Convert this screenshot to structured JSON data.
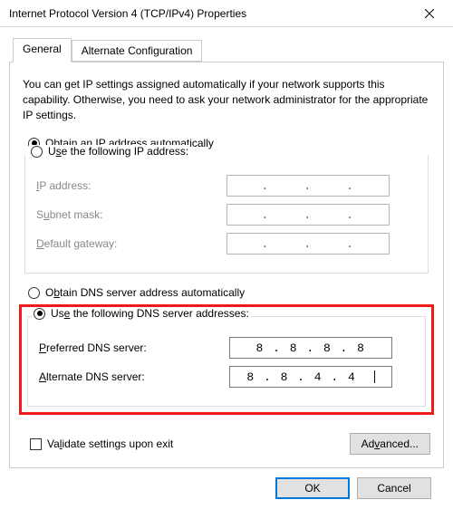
{
  "window": {
    "title": "Internet Protocol Version 4 (TCP/IPv4) Properties"
  },
  "tabs": {
    "general": "General",
    "alternate": "Alternate Configuration"
  },
  "intro": "You can get IP settings assigned automatically if your network supports this capability. Otherwise, you need to ask your network administrator for the appropriate IP settings.",
  "ip_section": {
    "auto_label": "Obtain an IP address automatically",
    "manual_label": "Use the following IP address:",
    "selected": "auto",
    "fields": {
      "ip_label": "IP address:",
      "subnet_label": "Subnet mask:",
      "gateway_label": "Default gateway:",
      "ip_value": "",
      "subnet_value": "",
      "gateway_value": ""
    }
  },
  "dns_section": {
    "auto_label": "Obtain DNS server address automatically",
    "manual_label": "Use the following DNS server addresses:",
    "selected": "manual",
    "fields": {
      "preferred_label": "Preferred DNS server:",
      "alternate_label": "Alternate DNS server:",
      "preferred_value": "8 . 8 . 8 . 8",
      "alternate_value": "8 . 8 . 4 . 4"
    }
  },
  "validate_label": "Validate settings upon exit",
  "validate_checked": false,
  "buttons": {
    "advanced": "Advanced...",
    "ok": "OK",
    "cancel": "Cancel"
  }
}
